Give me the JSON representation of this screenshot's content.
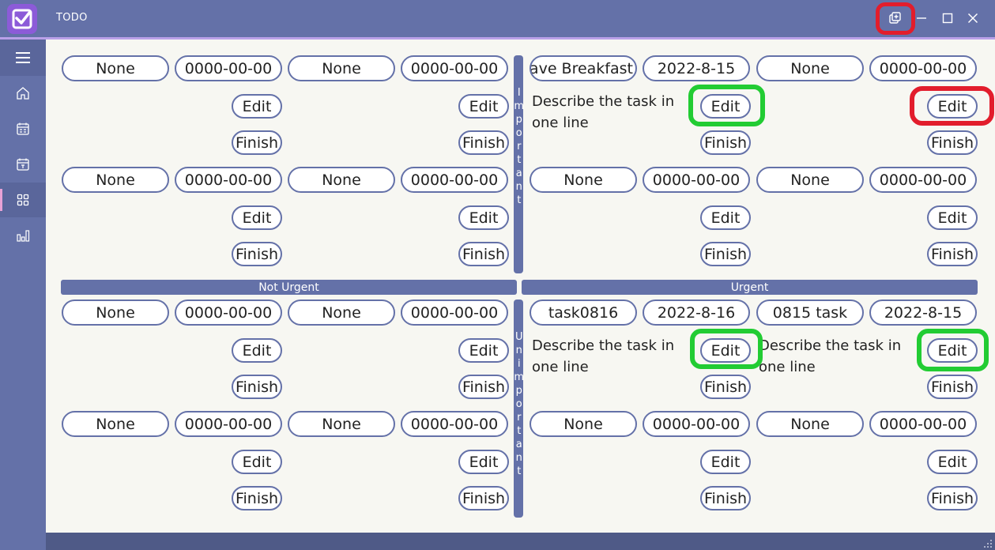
{
  "window": {
    "title": "TODO"
  },
  "titlebar_buttons": {
    "pin": "pin-window-icon",
    "minimize": "minimize-icon",
    "maximize": "maximize-icon",
    "close": "close-icon"
  },
  "sidebar": {
    "items": [
      {
        "icon": "menu-icon",
        "label": ""
      },
      {
        "icon": "home-icon",
        "label": ""
      },
      {
        "icon": "calendar-list-icon",
        "label": ""
      },
      {
        "icon": "calendar-day-icon",
        "label": ""
      },
      {
        "icon": "quadrant-icon",
        "label": "",
        "selected": true
      },
      {
        "icon": "bar-chart-icon",
        "label": ""
      }
    ]
  },
  "axis": {
    "important": "Important",
    "unimportant": "Unimportant",
    "not_urgent": "Not Urgent",
    "urgent": "Urgent"
  },
  "buttons": {
    "edit": "Edit",
    "finish": "Finish"
  },
  "quadrants": {
    "important_not_urgent": {
      "rows": [
        {
          "cards": [
            {
              "name": "None",
              "date": "0000-00-00"
            },
            {
              "name": "None",
              "date": "0000-00-00"
            }
          ]
        },
        {
          "cards": [
            {
              "name": "None",
              "date": "0000-00-00"
            },
            {
              "name": "None",
              "date": "0000-00-00"
            }
          ]
        }
      ]
    },
    "important_urgent": {
      "rows": [
        {
          "cards": [
            {
              "name": "Have Breakfast",
              "date": "2022-8-15",
              "description": "Describe the task in one line"
            },
            {
              "name": "None",
              "date": "0000-00-00"
            }
          ]
        },
        {
          "cards": [
            {
              "name": "None",
              "date": "0000-00-00"
            },
            {
              "name": "None",
              "date": "0000-00-00"
            }
          ]
        }
      ]
    },
    "unimportant_not_urgent": {
      "rows": [
        {
          "cards": [
            {
              "name": "None",
              "date": "0000-00-00"
            },
            {
              "name": "None",
              "date": "0000-00-00"
            }
          ]
        },
        {
          "cards": [
            {
              "name": "None",
              "date": "0000-00-00"
            },
            {
              "name": "None",
              "date": "0000-00-00"
            }
          ]
        }
      ]
    },
    "unimportant_urgent": {
      "rows": [
        {
          "cards": [
            {
              "name": "task0816",
              "date": "2022-8-16",
              "description": "Describe the task in one line"
            },
            {
              "name": "0815 task",
              "date": "2022-8-15",
              "description": "Describe the task in one line"
            }
          ]
        },
        {
          "cards": [
            {
              "name": "None",
              "date": "0000-00-00"
            },
            {
              "name": "None",
              "date": "0000-00-00"
            }
          ]
        }
      ]
    }
  },
  "colors": {
    "accent": "#6471a8",
    "background": "#f7f7f2",
    "highlight_green": "#22cc33",
    "highlight_red": "#e21d2c"
  }
}
